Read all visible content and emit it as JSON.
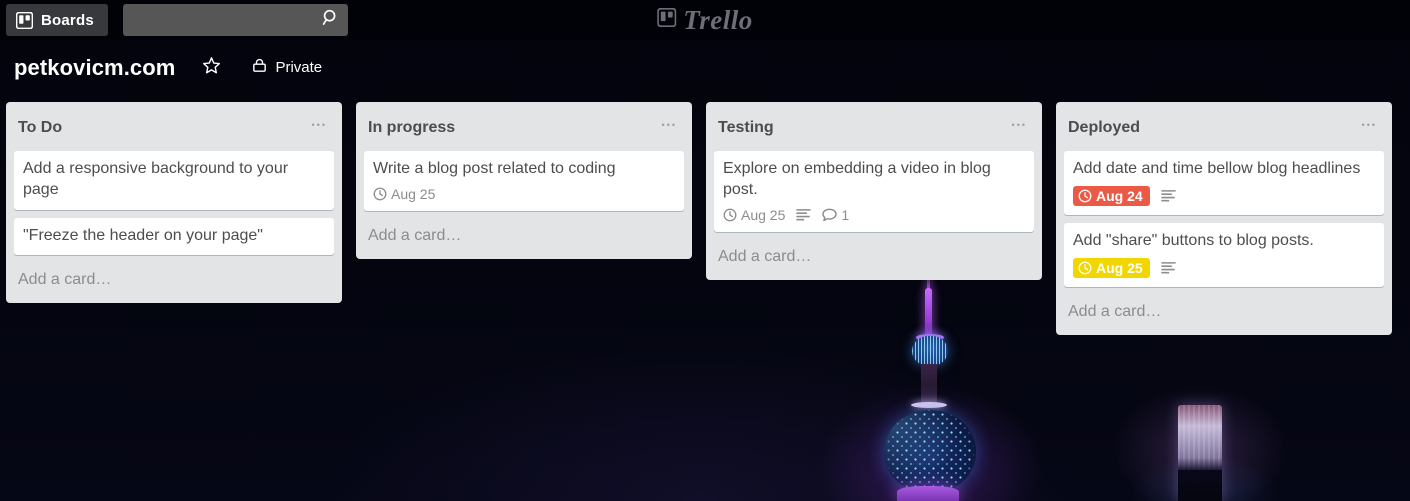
{
  "top_bar": {
    "boards_button_label": "Boards",
    "boards_icon": "board-icon",
    "search_value": "",
    "search_placeholder": "",
    "search_icon": "search-icon",
    "logo_text": "Trello",
    "logo_icon": "trello-board-icon"
  },
  "board_header": {
    "title": "petkovicm.com",
    "star_icon": "star-outline-icon",
    "visibility_icon": "lock-icon",
    "visibility_label": "Private"
  },
  "colors": {
    "list_background": "#e2e4e6",
    "card_background": "#ffffff",
    "card_text": "#4d4d4d",
    "muted_text": "#8c8c8c",
    "due_overdue": "#eb5a46",
    "due_soon": "#f2d600",
    "page_background": "#03040c"
  },
  "lists": [
    {
      "title": "To Do",
      "menu_icon": "ellipsis-icon",
      "add_card_label": "Add a card…",
      "cards": [
        {
          "title": "Add a responsive background to your page",
          "badges": []
        },
        {
          "title": "\"Freeze the header on your page\"",
          "badges": []
        }
      ]
    },
    {
      "title": "In progress",
      "menu_icon": "ellipsis-icon",
      "add_card_label": "Add a card…",
      "cards": [
        {
          "title": "Write a blog post related to coding",
          "badges": [
            {
              "type": "due",
              "icon": "clock-icon",
              "label": "Aug 25",
              "style": "plain"
            }
          ]
        }
      ]
    },
    {
      "title": "Testing",
      "menu_icon": "ellipsis-icon",
      "add_card_label": "Add a card…",
      "cards": [
        {
          "title": "Explore on embedding a video in blog post.",
          "badges": [
            {
              "type": "due",
              "icon": "clock-icon",
              "label": "Aug 25",
              "style": "plain"
            },
            {
              "type": "description",
              "icon": "description-icon",
              "label": ""
            },
            {
              "type": "comments",
              "icon": "comment-icon",
              "label": "1"
            }
          ]
        }
      ]
    },
    {
      "title": "Deployed",
      "menu_icon": "ellipsis-icon",
      "add_card_label": "Add a card…",
      "cards": [
        {
          "title": "Add date and time bellow blog headlines",
          "badges": [
            {
              "type": "due",
              "icon": "clock-icon",
              "label": "Aug 24",
              "style": "red"
            },
            {
              "type": "description",
              "icon": "description-icon",
              "label": ""
            }
          ]
        },
        {
          "title": "Add \"share\" buttons to blog posts.",
          "badges": [
            {
              "type": "due",
              "icon": "clock-icon",
              "label": "Aug 25",
              "style": "yellow"
            },
            {
              "type": "description",
              "icon": "description-icon",
              "label": ""
            }
          ]
        }
      ]
    }
  ]
}
